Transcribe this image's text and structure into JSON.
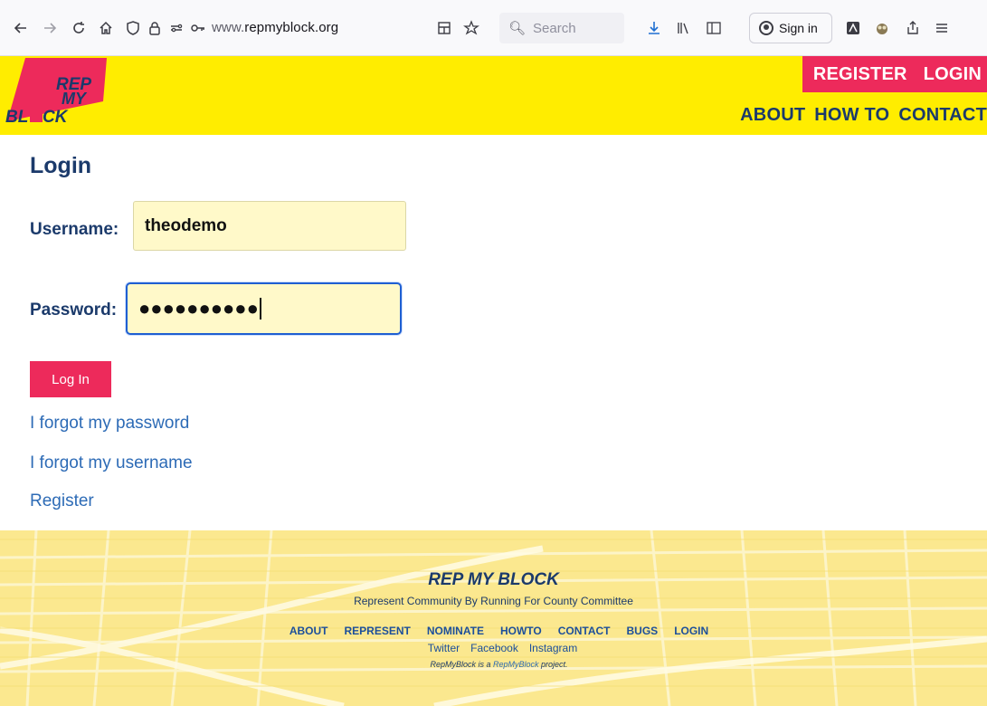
{
  "browser": {
    "url_prefix": "www.",
    "url_domain": "repmyblock.org",
    "search_placeholder": "Search",
    "signin_label": "Sign in"
  },
  "header": {
    "logo_lines": [
      "REP",
      "MY",
      "BL",
      "CK"
    ],
    "auth_links": [
      "REGISTER",
      "LOGIN"
    ],
    "nav_links": [
      "ABOUT",
      "HOW TO",
      "CONTACT"
    ],
    "colors": {
      "yellow": "#ffed00",
      "pink": "#ed2a5b",
      "navy": "#1b3a6b"
    }
  },
  "login": {
    "title": "Login",
    "username_label": "Username:",
    "username_value": "theodemo",
    "password_label": "Password:",
    "password_mask": "●●●●●●●●●●",
    "submit_label": "Log In",
    "forgot_password": "I forgot my password",
    "forgot_username": "I forgot my username",
    "register": "Register"
  },
  "footer": {
    "title": "REP MY BLOCK",
    "tagline_pre": "Represent Community By ",
    "tagline_link": "Running",
    "tagline_post": " For County Committee",
    "nav": [
      "ABOUT",
      "REPRESENT",
      "NOMINATE",
      "HOWTO",
      "CONTACT",
      "BUGS",
      "LOGIN"
    ],
    "social": [
      "Twitter",
      "Facebook",
      "Instagram"
    ],
    "credit_pre": "RepMyBlock is a ",
    "credit_link": "RepMyBlock",
    "credit_post": " project."
  }
}
